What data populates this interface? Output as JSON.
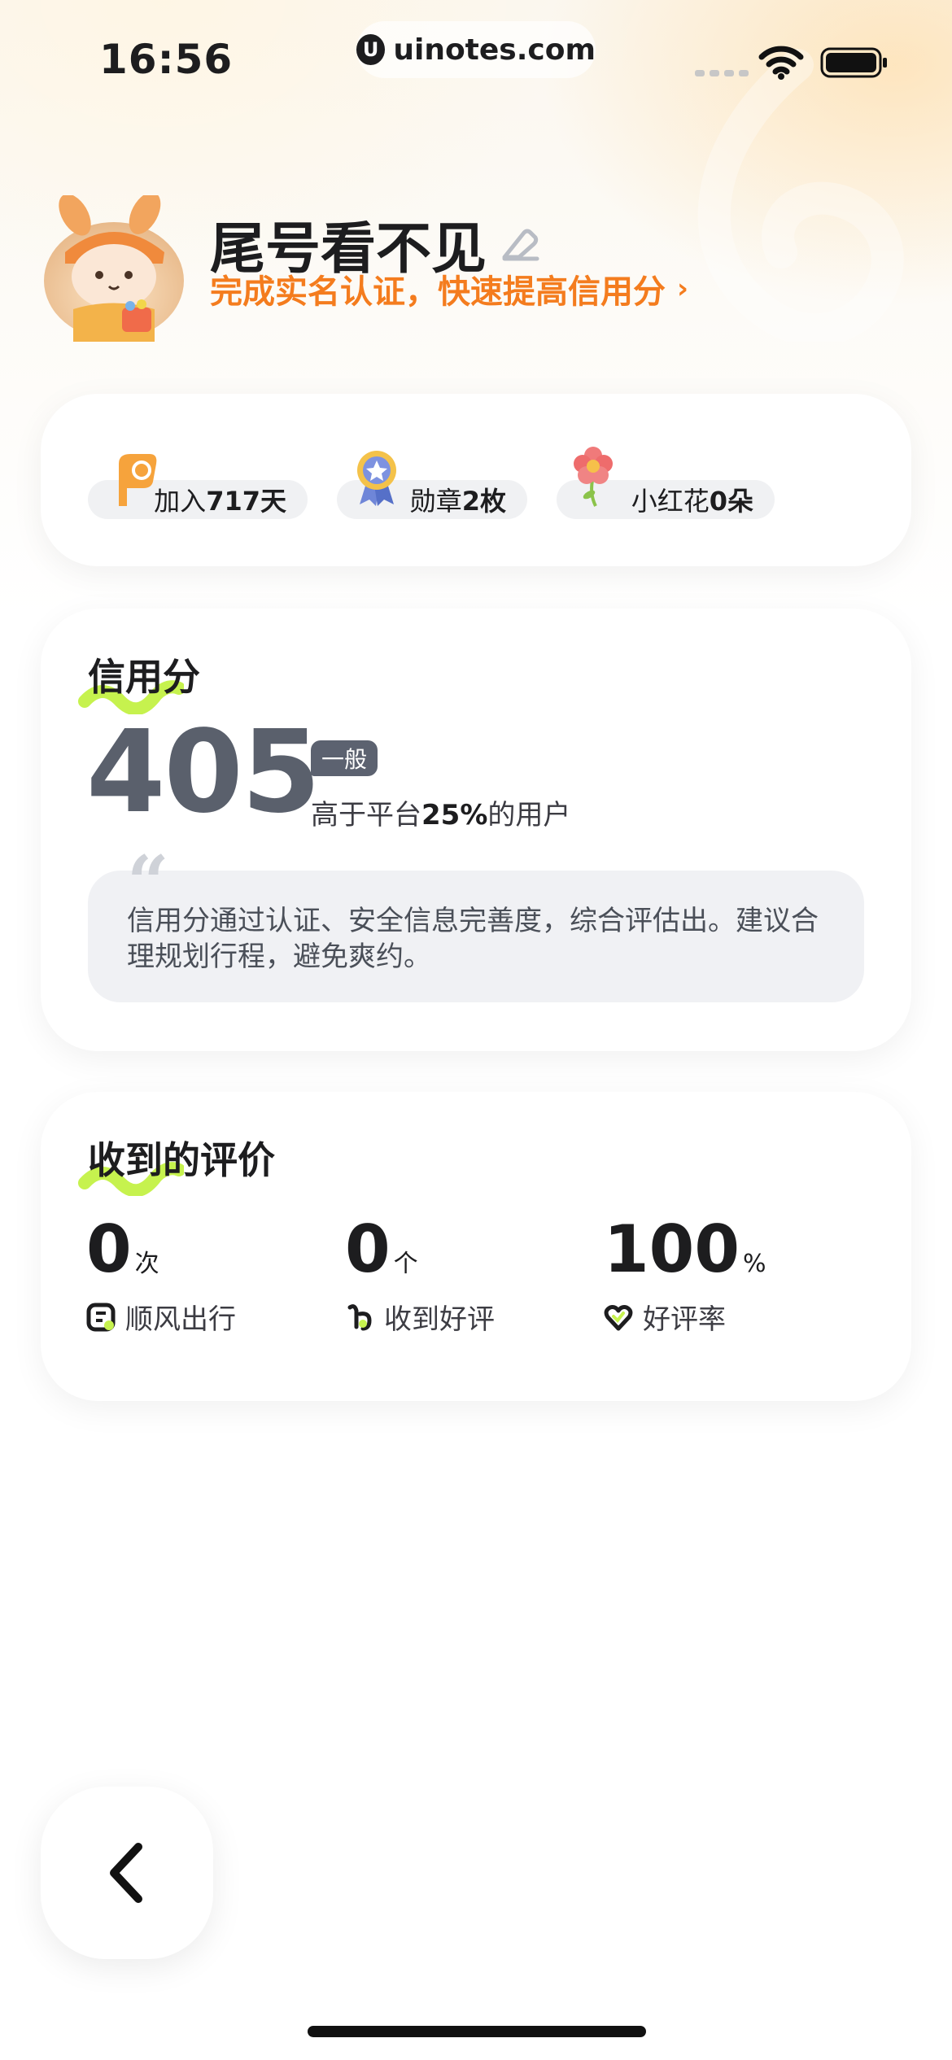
{
  "status_bar": {
    "time": "16:56",
    "url": "uinotes.com"
  },
  "profile": {
    "username": "尾号看不见",
    "verify_prompt": "完成实名认证，快速提高信用分",
    "verify_arrow": "›"
  },
  "stats": [
    {
      "prefix": "加入",
      "value": "717天",
      "icon": "flag-icon"
    },
    {
      "prefix": "勋章",
      "value": "2枚",
      "icon": "medal-icon"
    },
    {
      "prefix": "小红花",
      "value": "0朵",
      "icon": "flower-icon"
    }
  ],
  "credit": {
    "title": "信用分",
    "score": "405",
    "level": "一般",
    "percentile_prefix": "高于平台",
    "percentile_value": "25%",
    "percentile_suffix": "的用户",
    "quote_mark": "“",
    "description": "信用分通过认证、安全信息完善度，综合评估出。建议合理规划行程，避免爽约。"
  },
  "reviews": {
    "title": "收到的评价",
    "metrics": [
      {
        "value": "0",
        "unit": "次",
        "label": "顺风出行",
        "icon": "trip-icon"
      },
      {
        "value": "0",
        "unit": "个",
        "label": "收到好评",
        "icon": "thumbs-up-icon"
      },
      {
        "value": "100",
        "unit": "%",
        "label": "好评率",
        "icon": "heart-icon"
      }
    ]
  },
  "colors": {
    "accent_orange": "#f47c1e",
    "score_gray": "#5a606c",
    "highlight_green": "#c6f24e"
  }
}
